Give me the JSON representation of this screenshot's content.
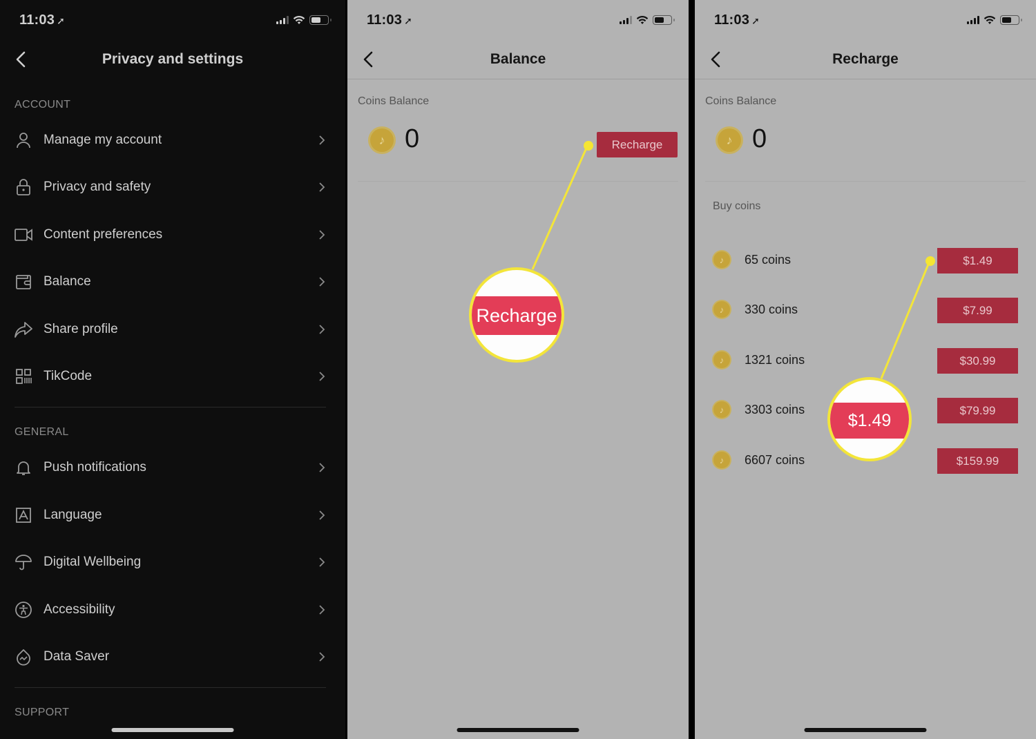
{
  "colors": {
    "dark_bg": "#0e0e0e",
    "light_bg": "#b3b3b3",
    "accent_red": "#a62c3e",
    "highlight_red": "#e33d57",
    "callout_yellow": "#f3e53a",
    "coin_gold": "#c6a43a"
  },
  "status_bar": {
    "time": "11:03",
    "location_icon": "location-arrow-icon"
  },
  "screen1": {
    "title": "Privacy and settings",
    "sections": [
      {
        "label": "ACCOUNT",
        "items": [
          {
            "label": "Manage my account",
            "icon": "person-icon"
          },
          {
            "label": "Privacy and safety",
            "icon": "lock-icon"
          },
          {
            "label": "Content preferences",
            "icon": "video-camera-icon"
          },
          {
            "label": "Balance",
            "icon": "wallet-icon"
          },
          {
            "label": "Share profile",
            "icon": "share-arrow-icon"
          },
          {
            "label": "TikCode",
            "icon": "qr-code-icon"
          }
        ]
      },
      {
        "label": "GENERAL",
        "items": [
          {
            "label": "Push notifications",
            "icon": "bell-icon"
          },
          {
            "label": "Language",
            "icon": "language-a-icon"
          },
          {
            "label": "Digital Wellbeing",
            "icon": "umbrella-icon"
          },
          {
            "label": "Accessibility",
            "icon": "accessibility-icon"
          },
          {
            "label": "Data Saver",
            "icon": "data-saver-icon"
          }
        ]
      },
      {
        "label": "SUPPORT",
        "items": []
      }
    ]
  },
  "screen2": {
    "title": "Balance",
    "coins_balance_label": "Coins Balance",
    "coins_balance_value": "0",
    "recharge_label": "Recharge",
    "callout_text": "Recharge"
  },
  "screen3": {
    "title": "Recharge",
    "coins_balance_label": "Coins Balance",
    "coins_balance_value": "0",
    "buy_coins_label": "Buy coins",
    "packages": [
      {
        "coins": "65 coins",
        "price": "$1.49"
      },
      {
        "coins": "330 coins",
        "price": "$7.99"
      },
      {
        "coins": "1321 coins",
        "price": "$30.99"
      },
      {
        "coins": "3303 coins",
        "price": "$79.99"
      },
      {
        "coins": "6607 coins",
        "price": "$159.99"
      }
    ],
    "callout_text": "$1.49"
  }
}
